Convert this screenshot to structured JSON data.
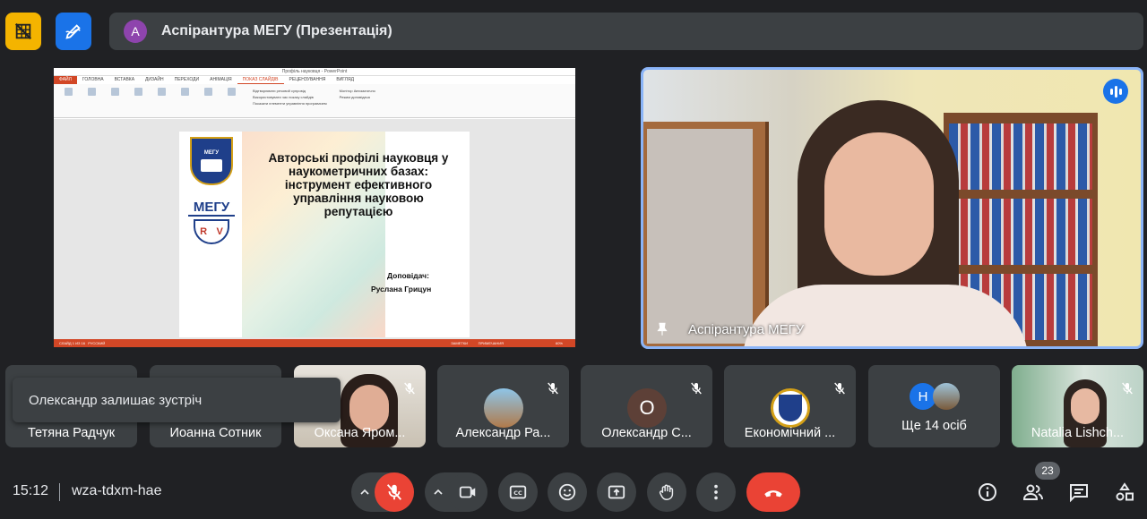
{
  "header": {
    "avatar_letter": "A",
    "title": "Аспірантура МЕГУ (Презентація)",
    "avatar_color": "#8e44ad"
  },
  "presentation": {
    "window_title": "Профіль науковця - PowerPoint",
    "file_tab": "ФАЙЛ",
    "tabs": [
      "ГОЛОВНА",
      "ВСТАВКА",
      "ДИЗАЙН",
      "ПЕРЕХОДИ",
      "АНІМАЦІЯ",
      "ПОКАЗ СЛАЙДІВ",
      "РЕЦЕНЗУВАННЯ",
      "ВИГЛЯД"
    ],
    "active_tab": "ПОКАЗ СЛАЙДІВ",
    "options": [
      "Відтворювати речовий супровід",
      "Використовувати час показу слайдів",
      "Показати елементи управління програвачем"
    ],
    "monitor_label": "Монітор",
    "monitor_value": "Автоматично",
    "presenter_view": "Режим доповідача",
    "logo1_text": "МЕГУ",
    "logo2_text": "МЕГУ",
    "logo2_letters": [
      "R",
      "V"
    ],
    "slide_title": "Авторські профілі науковця у наукометричних базах: інструмент ефективного управління науковою репутацією",
    "speaker_label": "Доповідач:",
    "speaker_name": "Руслана Грицун",
    "status_left": "СЛАЙД 1 ИЗ 16",
    "status_lang": "РУССКИЙ",
    "status_notes": "ЗАМЕТКИ",
    "status_comments": "ПРИМЕЧАНИЯ",
    "zoom": "60%"
  },
  "main_video": {
    "name": "Аспірантура МЕГУ"
  },
  "tiles": [
    {
      "name": "Тетяна Радчук"
    },
    {
      "name": "Иоанна Сотник"
    },
    {
      "name": "Оксана Яром..."
    },
    {
      "name": "Александр Ра..."
    },
    {
      "name": "Олександр С...",
      "initial": "О",
      "color": "#5d4037"
    },
    {
      "name": "Економічний ..."
    },
    {
      "name": "Ще 14 осіб",
      "initial": "Н",
      "color": "#1a73e8"
    },
    {
      "name": "Natalia Lishch..."
    }
  ],
  "toast": "Олександр залишає зустріч",
  "bottom": {
    "time": "15:12",
    "meeting_code": "wza-tdxm-hae",
    "participants_count": "23"
  },
  "colors": {
    "end_call": "#ea4335",
    "mic_off": "#ea4335",
    "highlight": "#8ab4f8"
  }
}
